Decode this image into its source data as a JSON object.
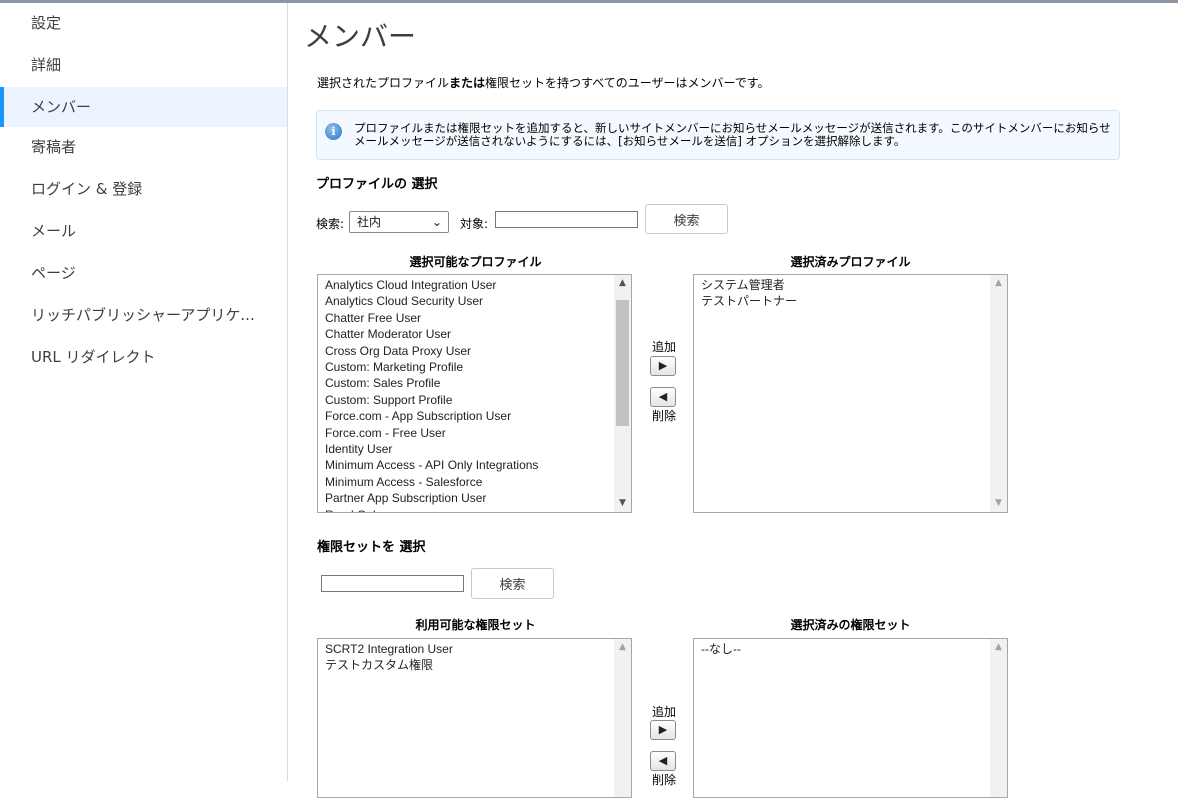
{
  "sidebar": {
    "items": [
      {
        "label": "設定"
      },
      {
        "label": "詳細"
      },
      {
        "label": "メンバー"
      },
      {
        "label": "寄稿者"
      },
      {
        "label": "ログイン & 登録"
      },
      {
        "label": "メール"
      },
      {
        "label": "ページ"
      },
      {
        "label": "リッチパブリッシャーアプリケ..."
      },
      {
        "label": "URL リダイレクト"
      }
    ]
  },
  "main": {
    "title": "メンバー",
    "description": {
      "part1": "選択されたプロファイル",
      "bold": "または",
      "part2": "権限セットを持つすべてのユーザーはメンバーです。"
    },
    "info": "プロファイルまたは権限セットを追加すると、新しいサイトメンバーにお知らせメールメッセージが送信されます。このサイトメンバーにお知らせメールメッセージが送信されないようにするには、[お知らせメールを送信] オプションを選択解除します。",
    "profiles": {
      "section_title": "プロファイルの 選択",
      "search_label": "検索:",
      "search_scope": "社内",
      "target_label": "対象:",
      "search_value": "",
      "search_button": "検索",
      "available_header": "選択可能なプロファイル",
      "selected_header": "選択済みプロファイル",
      "available": [
        "Analytics Cloud Integration User",
        "Analytics Cloud Security User",
        "Chatter Free User",
        "Chatter Moderator User",
        "Cross Org Data Proxy User",
        "Custom: Marketing Profile",
        "Custom: Sales Profile",
        "Custom: Support Profile",
        "Force.com - App Subscription User",
        "Force.com - Free User",
        "Identity User",
        "Minimum Access - API Only Integrations",
        "Minimum Access - Salesforce",
        "Partner App Subscription User",
        "Read Only"
      ],
      "selected": [
        "システム管理者",
        "テストパートナー"
      ],
      "add_label": "追加",
      "remove_label": "削除"
    },
    "permsets": {
      "section_title": "権限セットを 選択",
      "search_value": "",
      "search_button": "検索",
      "available_header": "利用可能な権限セット",
      "selected_header": "選択済みの権限セット",
      "available": [
        "SCRT2 Integration User",
        "テストカスタム権限"
      ],
      "selected": [
        "--なし--"
      ],
      "add_label": "追加",
      "remove_label": "削除"
    }
  },
  "icons": {
    "info": "info-icon",
    "dropdown": "chevron-down-icon",
    "add": "triangle-right-icon",
    "remove": "triangle-left-icon"
  }
}
